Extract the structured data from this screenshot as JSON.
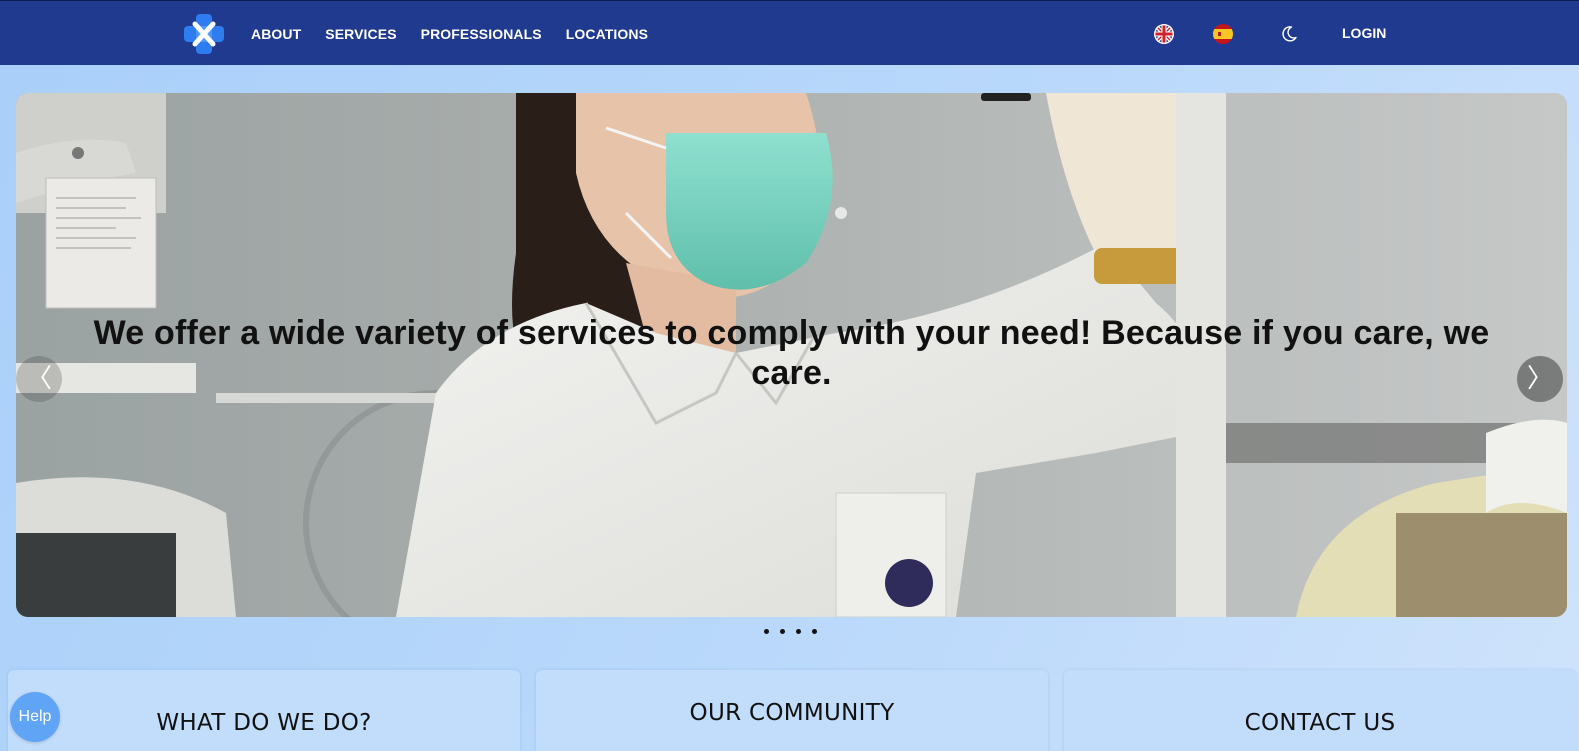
{
  "nav": {
    "logo_name": "medical-cross-logo",
    "links": [
      "ABOUT",
      "SERVICES",
      "PROFESSIONALS",
      "LOCATIONS"
    ],
    "languages": [
      "English",
      "Español"
    ],
    "theme_icon": "moon-icon",
    "login_label": "LOGIN"
  },
  "hero": {
    "caption": "We offer a wide variety of services to comply with your need! Because if you care, we care.",
    "prev_symbol": "〈",
    "next_symbol": "〉",
    "slide_count": 4
  },
  "cards": [
    {
      "title": "WHAT DO WE DO?"
    },
    {
      "title": "OUR COMMUNITY"
    },
    {
      "title": "CONTACT US"
    }
  ],
  "help": {
    "label": "Help"
  },
  "colors": {
    "navbar": "#1f3a8f",
    "page_background": "#b9d8fb",
    "card_background": "#c2dcfc",
    "help_button": "#5fa4f5",
    "logo_blue": "#2e7df0"
  }
}
